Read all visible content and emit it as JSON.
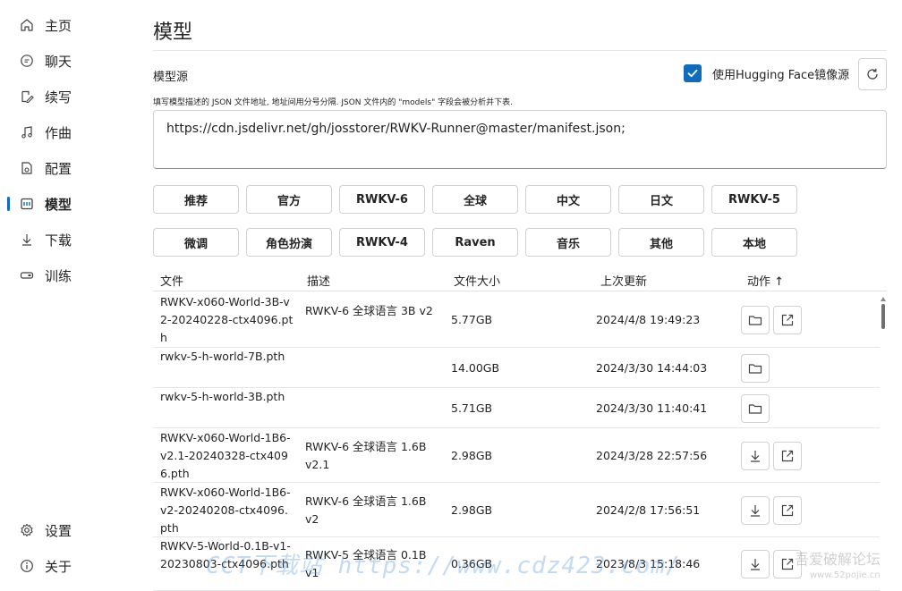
{
  "sidebar": {
    "items": [
      {
        "label": "主页",
        "icon": "home-icon"
      },
      {
        "label": "聊天",
        "icon": "chat-icon"
      },
      {
        "label": "续写",
        "icon": "edit-icon"
      },
      {
        "label": "作曲",
        "icon": "music-note-icon"
      },
      {
        "label": "配置",
        "icon": "config-icon"
      },
      {
        "label": "模型",
        "icon": "model-icon"
      },
      {
        "label": "下载",
        "icon": "download-icon"
      },
      {
        "label": "训练",
        "icon": "train-icon"
      }
    ],
    "bottom": [
      {
        "label": "设置",
        "icon": "gear-icon"
      },
      {
        "label": "关于",
        "icon": "info-icon"
      }
    ],
    "active": "模型"
  },
  "page": {
    "title": "模型",
    "source_label": "模型源",
    "mirror_label": "使用Hugging Face镜像源",
    "mirror_checked": true,
    "hint": "填写模型描述的 JSON 文件地址, 地址间用分号分隔. JSON 文件内的 \"models\" 字段会被分析并下表.",
    "url_value": "https://cdn.jsdelivr.net/gh/josstorer/RWKV-Runner@master/manifest.json;"
  },
  "tags_row1": [
    "推荐",
    "官方",
    "RWKV-6",
    "全球",
    "中文",
    "日文",
    "RWKV-5"
  ],
  "tags_row2": [
    "微调",
    "角色扮演",
    "RWKV-4",
    "Raven",
    "音乐",
    "其他",
    "本地"
  ],
  "table": {
    "headers": {
      "file": "文件",
      "desc": "描述",
      "size": "文件大小",
      "updated": "上次更新",
      "action": "动作 ↑"
    },
    "rows": [
      {
        "file": "RWKV-x060-World-3B-v2-20240228-ctx4096.pth",
        "desc": "RWKV-6 全球语言 3B v2",
        "size": "5.77GB",
        "updated": "2024/4/8 19:49:23",
        "actions": [
          "folder",
          "open"
        ]
      },
      {
        "file": "rwkv-5-h-world-7B.pth",
        "desc": "",
        "size": "14.00GB",
        "updated": "2024/3/30 14:44:03",
        "actions": [
          "folder"
        ]
      },
      {
        "file": "rwkv-5-h-world-3B.pth",
        "desc": "",
        "size": "5.71GB",
        "updated": "2024/3/30 11:40:41",
        "actions": [
          "folder"
        ]
      },
      {
        "file": "RWKV-x060-World-1B6-v2.1-20240328-ctx4096.pth",
        "desc": "RWKV-6 全球语言 1.6B v2.1",
        "size": "2.98GB",
        "updated": "2024/3/28 22:57:56",
        "actions": [
          "download",
          "open"
        ]
      },
      {
        "file": "RWKV-x060-World-1B6-v2-20240208-ctx4096.pth",
        "desc": "RWKV-6 全球语言 1.6B v2",
        "size": "2.98GB",
        "updated": "2024/2/8 17:56:51",
        "actions": [
          "download",
          "open"
        ]
      },
      {
        "file": "RWKV-5-World-0.1B-v1-20230803-ctx4096.pth",
        "desc": "RWKV-5 全球语言 0.1B v1",
        "size": "0.36GB",
        "updated": "2023/8/3 15:18:46",
        "actions": [
          "download",
          "open"
        ]
      }
    ]
  },
  "watermark": {
    "text1": "CCT下载站  https://www.cdz423.com/",
    "text2": "吾爱破解论坛",
    "text3": "www.52pojie.cn"
  },
  "colors": {
    "accent": "#0f6cbd",
    "border": "#d1d1d1",
    "text": "#242424"
  }
}
